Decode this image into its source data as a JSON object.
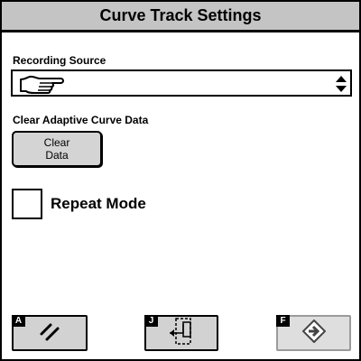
{
  "header": {
    "title": "Curve Track Settings"
  },
  "recording_source": {
    "label": "Recording Source",
    "selected_icon": "pointing-hand-icon"
  },
  "adaptive": {
    "label": "Clear Adaptive Curve Data",
    "button_line1": "Clear",
    "button_line2": "Data"
  },
  "repeat_mode": {
    "label": "Repeat Mode",
    "checked": false
  },
  "softkeys": [
    {
      "key": "A",
      "icon": "double-slash-icon"
    },
    {
      "key": "J",
      "icon": "import-icon"
    },
    {
      "key": "F",
      "icon": "next-icon",
      "enabled": false
    }
  ],
  "colors": {
    "titlebar": "#c4c4c4",
    "button": "#d4d4d4",
    "border": "#000000"
  }
}
